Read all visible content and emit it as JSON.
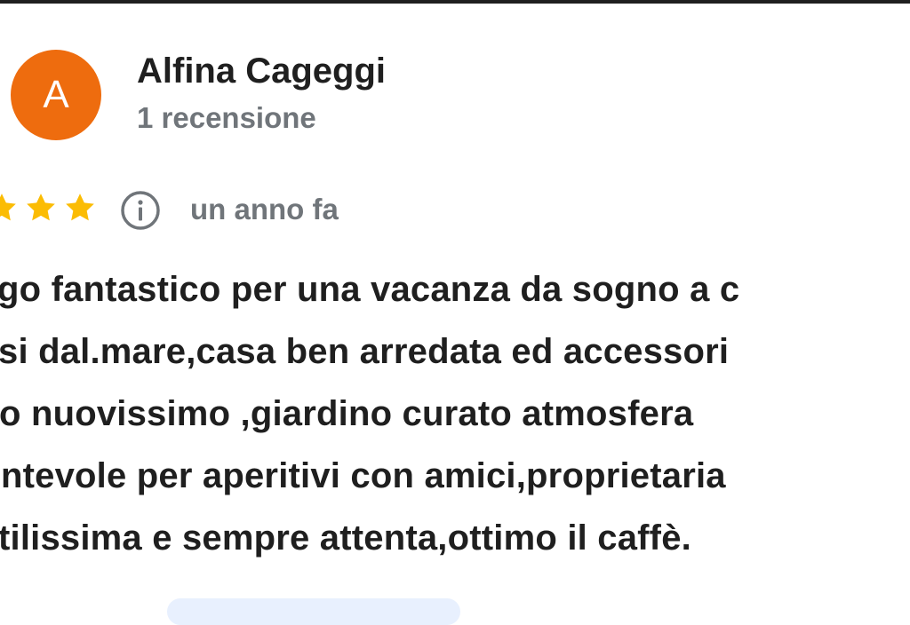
{
  "reviewer": {
    "avatar_letter": "A",
    "avatar_color": "#ee6c0e",
    "name": "Alfina Cageggi",
    "review_count": "1 recensione"
  },
  "rating": {
    "stars_visible": 3,
    "star_color": "#fbbc04",
    "info_icon": "info-icon",
    "date": "un anno fa"
  },
  "review": {
    "lines": [
      "go fantastico per una vacanza da sogno a c",
      "si dal.mare,casa ben arredata ed accessori",
      "o nuovissimo ,giardino curato atmosfera",
      "ntevole per aperitivi con amici,proprietaria",
      "tilissima e sempre attenta,ottimo il caffè."
    ]
  },
  "colors": {
    "text_primary": "#1f1f1f",
    "text_secondary": "#70757a",
    "chip_background": "#e8f0fe"
  }
}
